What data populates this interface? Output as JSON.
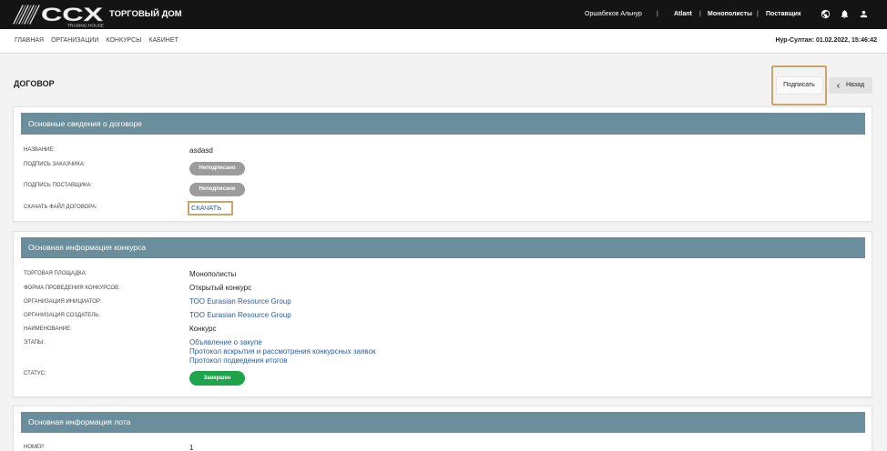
{
  "colors": {
    "header_bg": "#141414",
    "card_header_bg": "#6b8e9c",
    "link": "#2c5e9e",
    "badge_unsigned": "#9c9c9c",
    "badge_done": "#1ea54b",
    "highlight": "#c9a46b"
  },
  "header": {
    "logo": {
      "text": "CCX",
      "subtext": "TRADING HOUSE"
    },
    "brand_title": "ТОРГОВЫЙ ДОМ",
    "user_name": "Оршабеков Альнур",
    "separator": "|",
    "organization": "Atlant",
    "platform": "Монополисты",
    "role": "Поставщик",
    "icons": {
      "language": "globe-icon",
      "notifications": "bell-icon",
      "profile": "user-icon"
    }
  },
  "nav": {
    "items": [
      "ГЛАВНАЯ",
      "ОРГАНИЗАЦИИ",
      "КОНКУРСЫ",
      "КАБИНЕТ"
    ],
    "datetime": "Нур-Султан: 01.02.2022, 15:46:42"
  },
  "page": {
    "title": "ДОГОВОР",
    "sign_button": "Подписать",
    "back_button": "Назад",
    "back_icon": "chevron-left-icon"
  },
  "contract_card": {
    "title": "Основные сведения о договоре",
    "name": {
      "label": "НАЗВАНИЕ:",
      "value": "asdasd"
    },
    "customer_signature": {
      "label": "ПОДПИСЬ ЗАКАЗЧИКА:",
      "status": "Неподписано"
    },
    "supplier_signature": {
      "label": "ПОДПИСЬ ПОСТАВЩИКА:",
      "status": "Неподписано"
    },
    "download": {
      "label": "СКАЧАТЬ ФАЙЛ ДОГОВОРА:",
      "link": "СКАЧАТЬ"
    }
  },
  "tender_card": {
    "title": "Основная информация конкурса",
    "trading_platform": {
      "label": "ТОРГОВАЯ ПЛОЩАДКА:",
      "value": "Монополисты"
    },
    "tender_form": {
      "label": "ФОРМА ПРОВЕДЕНИЯ КОНКУРСОВ:",
      "value": "Открытый конкурс"
    },
    "initiator": {
      "label": "ОРГАНИЗАЦИЯ ИНИЦИАТОР:",
      "value": "ТОО Eurasian Resource Group"
    },
    "creator": {
      "label": "ОРГАНИЗАЦИЯ СОЗДАТЕЛЬ:",
      "value": "ТОО Eurasian Resource Group"
    },
    "name": {
      "label": "НАИМЕНОВАНИЕ:",
      "value": "Конкурс"
    },
    "stages": {
      "label": "ЭТАПЫ:",
      "items": [
        "Объявление о закупе",
        "Протокол вскрытия и рассмотрения конкурсных заявок",
        "Протокол подведения итогов"
      ]
    },
    "status": {
      "label": "СТАТУС:",
      "value": "Завершен"
    }
  },
  "lot_card": {
    "title": "Основная информация лота",
    "number": {
      "label": "НОМЕР:",
      "value": "1"
    }
  }
}
